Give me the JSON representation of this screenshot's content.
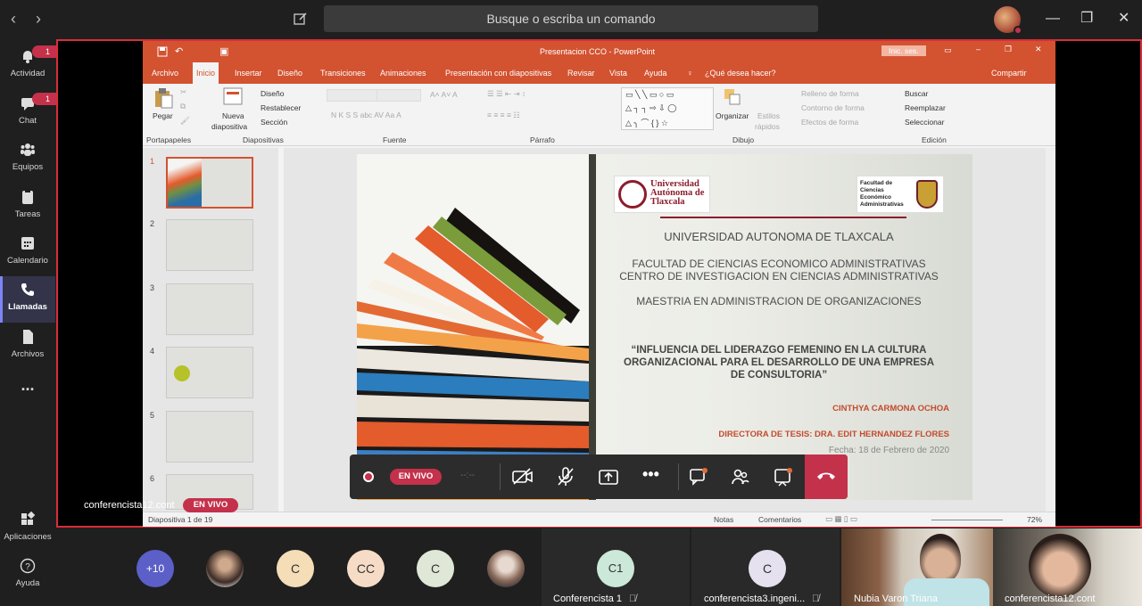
{
  "teams": {
    "search_placeholder": "Busque o escriba un comando",
    "nav_back": "‹",
    "nav_forward": "›",
    "window": {
      "minimize": "—",
      "restore": "❐",
      "close": "✕"
    },
    "rail": [
      {
        "label": "Actividad",
        "badge": "1"
      },
      {
        "label": "Chat",
        "badge": "1"
      },
      {
        "label": "Equipos"
      },
      {
        "label": "Tareas"
      },
      {
        "label": "Calendario"
      },
      {
        "label": "Llamadas",
        "active": true
      },
      {
        "label": "Archivos"
      },
      {
        "label": "..."
      }
    ],
    "rail_bottom": [
      {
        "label": "Aplicaciones"
      },
      {
        "label": "Ayuda"
      }
    ],
    "accent": "#7f85f5",
    "live_color": "#c4314b"
  },
  "ppt": {
    "window_title": "Presentacion CCO  -  PowerPoint",
    "signin": "Inic. ses.",
    "tabs": [
      "Archivo",
      "Inicio",
      "Insertar",
      "Diseño",
      "Transiciones",
      "Animaciones",
      "Presentación con diapositivas",
      "Revisar",
      "Vista",
      "Ayuda"
    ],
    "tell_me": "¿Qué desea hacer?",
    "share": "Compartir",
    "ribbon": {
      "paste": "Pegar",
      "new_slide_1": "Nueva",
      "new_slide_2": "diapositiva",
      "layout": "Diseño",
      "reset": "Restablecer",
      "section": "Sección",
      "arrange": "Organizar",
      "quick_styles_1": "Estilos",
      "quick_styles_2": "rápidos",
      "fill": "Relleno de forma",
      "outline": "Contorno de forma",
      "effects": "Efectos de forma",
      "find": "Buscar",
      "replace": "Reemplazar",
      "select": "Seleccionar",
      "groups": [
        "Portapapeles",
        "Diapositivas",
        "Fuente",
        "Párrafo",
        "Dibujo",
        "Edición"
      ]
    },
    "slide_numbers": [
      "1",
      "2",
      "3",
      "4",
      "5",
      "6"
    ],
    "status": {
      "slide": "Diapositiva 1 de 19",
      "notes": "Notas",
      "comments": "Comentarios",
      "zoom": "72%"
    },
    "brand_color": "#d35230"
  },
  "slide": {
    "logo_left_1": "Universidad",
    "logo_left_2": "Autónoma de",
    "logo_left_3": "Tlaxcala",
    "logo_right_1": "Facultad de",
    "logo_right_2": "Ciencias",
    "logo_right_3": "Económico",
    "logo_right_4": "Administrativas",
    "university": "UNIVERSIDAD AUTONOMA DE TLAXCALA",
    "faculty_1": "FACULTAD DE CIENCIAS ECONOMICO ADMINISTRATIVAS",
    "faculty_2": "CENTRO DE INVESTIGACION EN CIENCIAS ADMINISTRATIVAS",
    "master": "MAESTRIA EN ADMINISTRACION DE ORGANIZACIONES",
    "thesis_1": "“INFLUENCIA DEL LIDERAZGO FEMENINO EN LA CULTURA",
    "thesis_2": "ORGANIZACIONAL PARA EL DESARROLLO DE UNA EMPRESA",
    "thesis_3": "DE CONSULTORIA”",
    "author": "CINTHYA CARMONA OCHOA",
    "director": "DIRECTORA DE TESIS: DRA. EDIT HERNANDEZ FLORES",
    "date": "Fecha: 18 de Febrero de 2020"
  },
  "call": {
    "live_label": "EN VIVO",
    "timer": "--:--",
    "presenter": "conferencista12.cont",
    "overflow": "+10",
    "participants": [
      {
        "initials": "C"
      },
      {
        "initials": "CC"
      },
      {
        "initials": "C"
      }
    ],
    "tiles": [
      {
        "initials": "C1",
        "name": "Conferencista 1"
      },
      {
        "initials": "C",
        "name": "conferencista3.ingeni..."
      },
      {
        "name": "Nubia Varon Triana"
      },
      {
        "name": "conferencista12.cont"
      }
    ]
  }
}
